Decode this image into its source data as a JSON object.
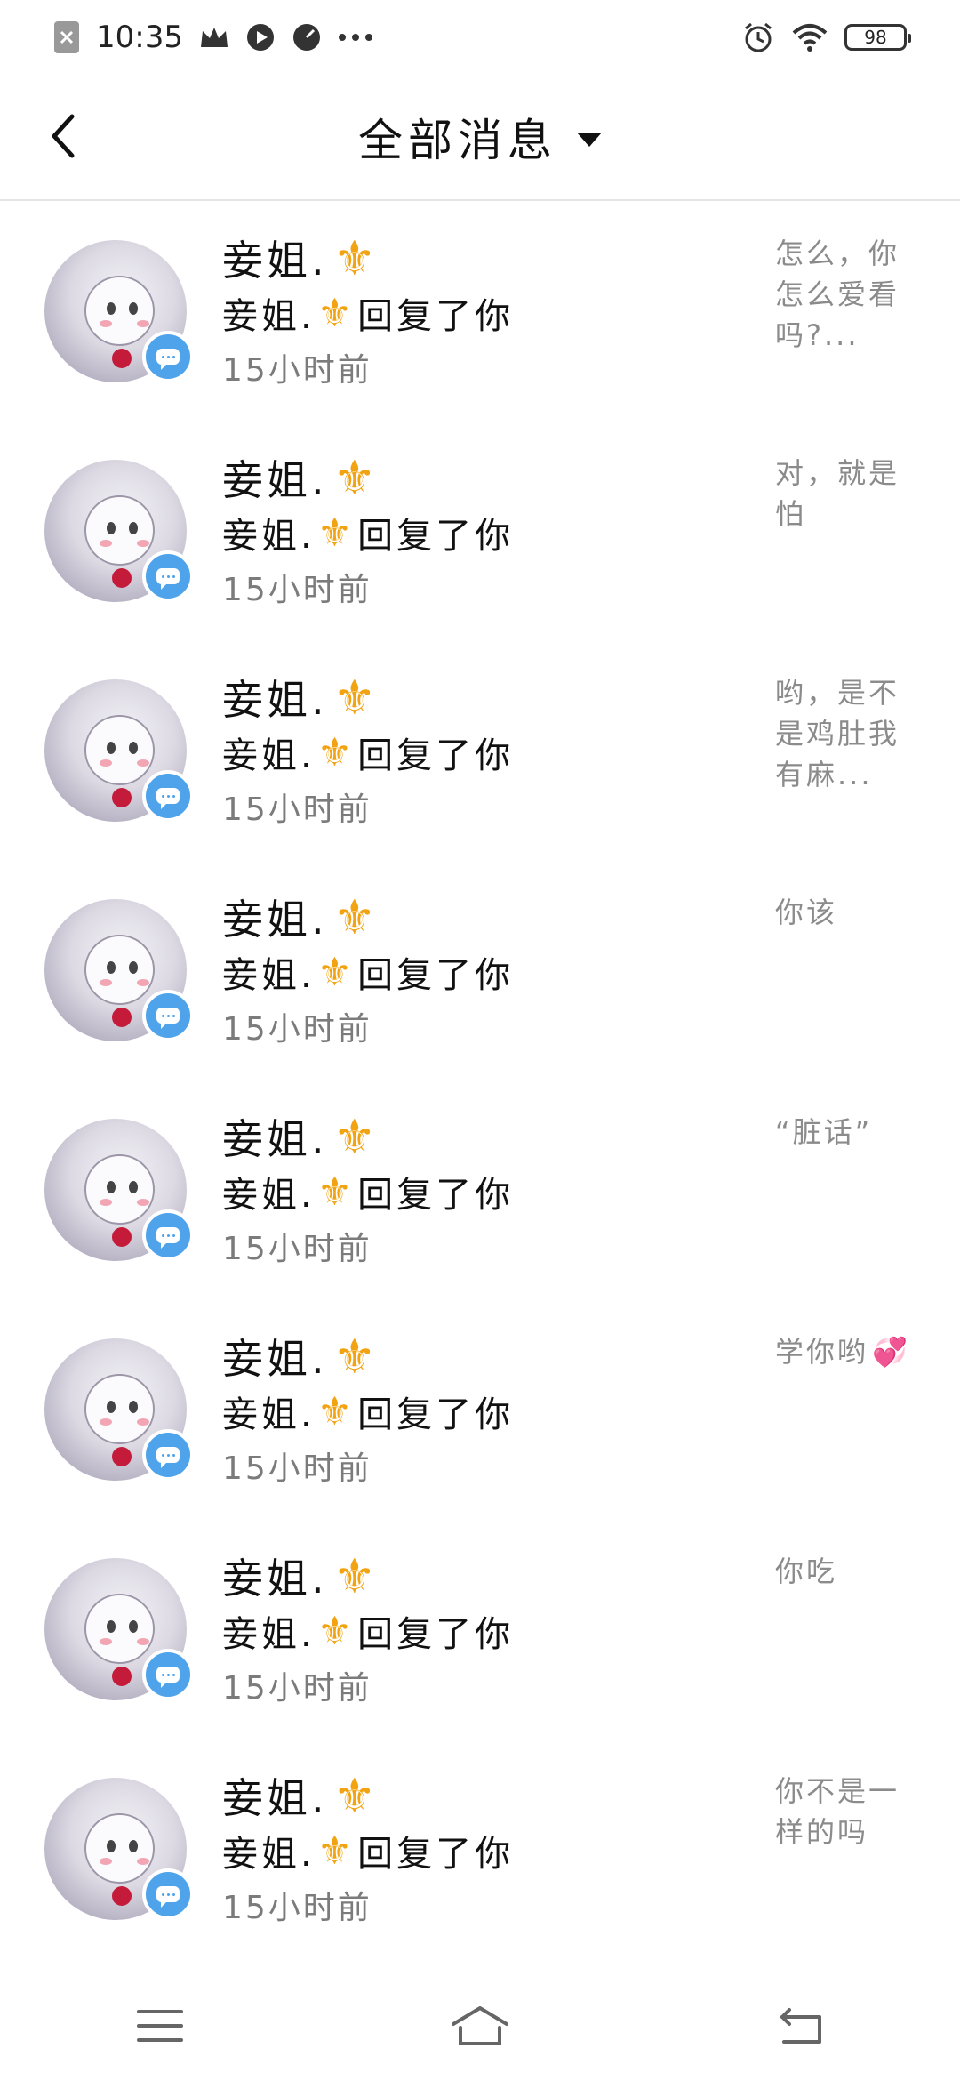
{
  "status_bar": {
    "time": "10:35",
    "battery": "98",
    "left_icons": [
      "x-box-icon",
      "crown-icon",
      "record-icon",
      "speed-icon",
      "more-icon"
    ],
    "right_icons": [
      "alarm-icon",
      "wifi-icon",
      "battery-icon"
    ]
  },
  "header": {
    "title": "全部消息"
  },
  "messages": [
    {
      "name": "妾姐.",
      "reply_name": "妾姐.",
      "reply_text": "回复了你",
      "time": "15小时前",
      "preview": "怎么，你怎么爱看吗?..."
    },
    {
      "name": "妾姐.",
      "reply_name": "妾姐.",
      "reply_text": "回复了你",
      "time": "15小时前",
      "preview": "对，就是怕"
    },
    {
      "name": "妾姐.",
      "reply_name": "妾姐.",
      "reply_text": "回复了你",
      "time": "15小时前",
      "preview": "哟，是不是鸡肚我有麻..."
    },
    {
      "name": "妾姐.",
      "reply_name": "妾姐.",
      "reply_text": "回复了你",
      "time": "15小时前",
      "preview": "你该"
    },
    {
      "name": "妾姐.",
      "reply_name": "妾姐.",
      "reply_text": "回复了你",
      "time": "15小时前",
      "preview": "“脏话”"
    },
    {
      "name": "妾姐.",
      "reply_name": "妾姐.",
      "reply_text": "回复了你",
      "time": "15小时前",
      "preview": "学你哟",
      "preview_emoji": "💞"
    },
    {
      "name": "妾姐.",
      "reply_name": "妾姐.",
      "reply_text": "回复了你",
      "time": "15小时前",
      "preview": "你吃"
    },
    {
      "name": "妾姐.",
      "reply_name": "妾姐.",
      "reply_text": "回复了你",
      "time": "15小时前",
      "preview": "你不是一样的吗"
    }
  ],
  "nav": {
    "icons": [
      "menu-icon",
      "home-icon",
      "back-icon"
    ]
  },
  "colors": {
    "accent_blue": "#4ea3ea",
    "fleur_gold": "#f2a312",
    "secondary_text": "#7b7b7b"
  }
}
